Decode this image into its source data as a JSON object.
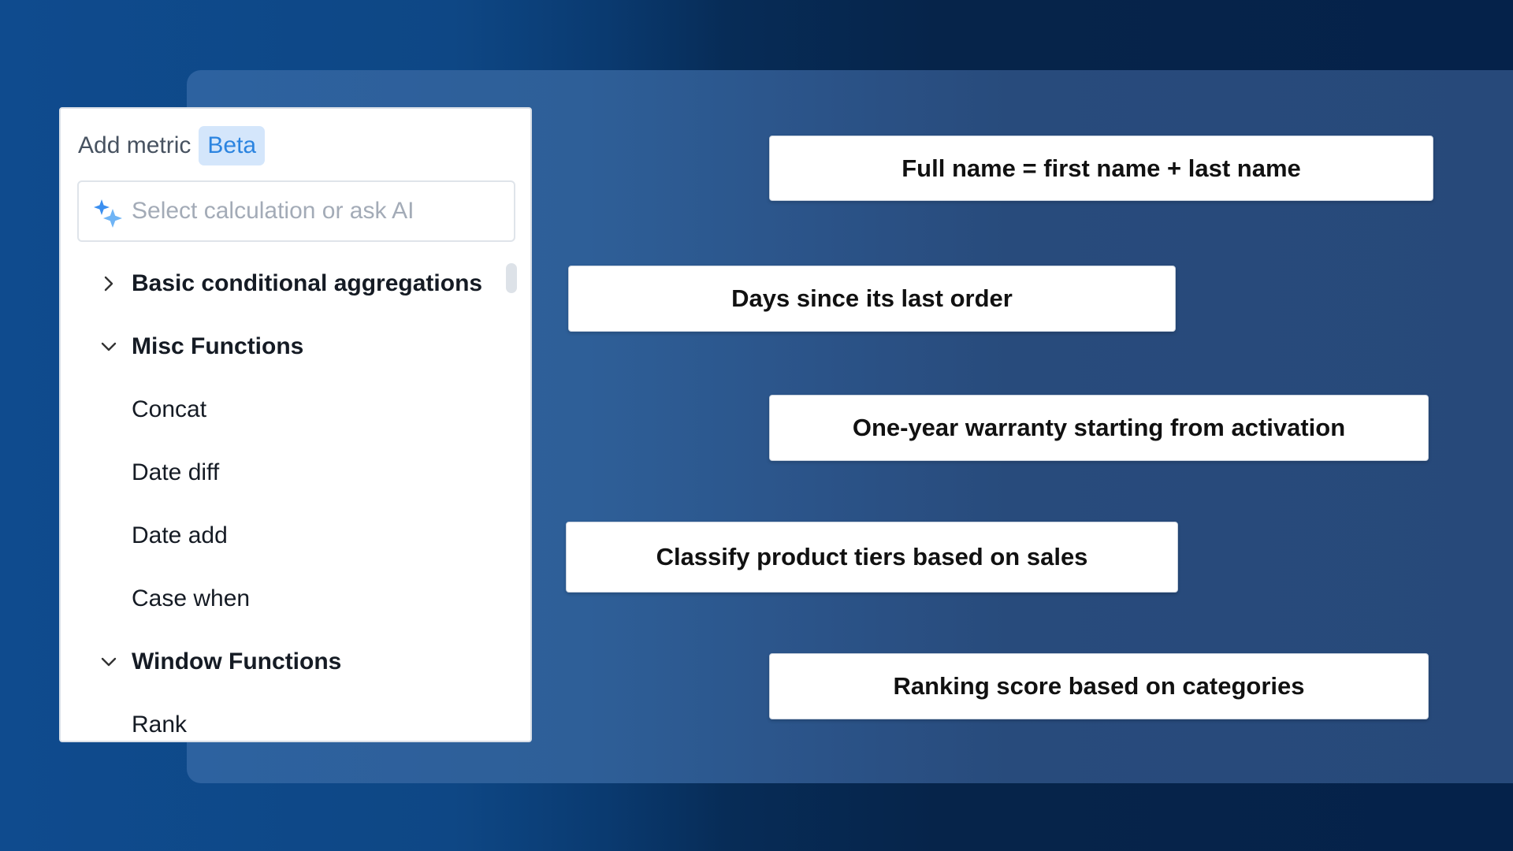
{
  "panel": {
    "title": "Add metric",
    "badge": "Beta",
    "search": {
      "placeholder": "Select calculation or ask AI",
      "icon": "sparkle-icon"
    },
    "items": [
      {
        "type": "group",
        "label": "Basic conditional aggregations",
        "expanded": false
      },
      {
        "type": "group",
        "label": "Misc Functions",
        "expanded": true
      },
      {
        "type": "item",
        "label": "Concat"
      },
      {
        "type": "item",
        "label": "Date diff"
      },
      {
        "type": "item",
        "label": "Date add"
      },
      {
        "type": "item",
        "label": "Case when"
      },
      {
        "type": "group",
        "label": "Window Functions",
        "expanded": true
      },
      {
        "type": "item",
        "label": "Rank"
      }
    ]
  },
  "examples": [
    "Full name = first name + last name",
    "Days since its last order",
    "One-year warranty starting from activation",
    "Classify product tiers based on sales",
    "Ranking score based on categories"
  ],
  "colors": {
    "background": "#0f4b8e",
    "backdrop": "#2d62a0",
    "badge_bg": "#d4e6fb",
    "badge_text": "#2b84e0",
    "sparkle_primary": "#3b8ff0",
    "sparkle_secondary": "#6fb4f5"
  }
}
